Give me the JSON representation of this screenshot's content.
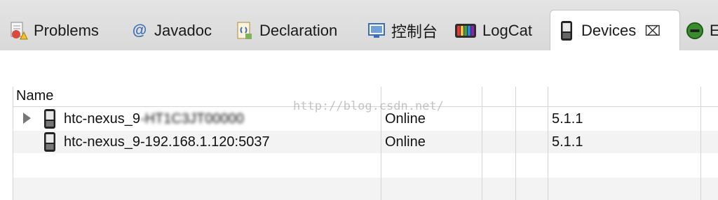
{
  "tabs": [
    {
      "label": "Problems",
      "icon": "problems-icon"
    },
    {
      "label": "Javadoc",
      "icon": "at-icon"
    },
    {
      "label": "Declaration",
      "icon": "declaration-icon"
    },
    {
      "label": "控制台",
      "icon": "console-icon"
    },
    {
      "label": "LogCat",
      "icon": "logcat-icon"
    },
    {
      "label": "Devices",
      "icon": "phone-icon",
      "active": true,
      "close": "⌧"
    },
    {
      "label": "E",
      "icon": "emulator-icon"
    }
  ],
  "table": {
    "header": {
      "name": "Name"
    },
    "rows": [
      {
        "name_visible": "htc-nexus_9",
        "name_obscured": "-HT1C3JT00000",
        "status": "Online",
        "version": "5.1.1",
        "expandable": true
      },
      {
        "name": "htc-nexus_9-192.168.1.120:5037",
        "status": "Online",
        "version": "5.1.1",
        "expandable": false
      }
    ]
  },
  "watermark": "http://blog.csdn.net/",
  "colors": {
    "tabbar_bg": "#dedede",
    "panel_bg": "#ffffff",
    "alt_row_bg": "#f3f3f3",
    "grid_line": "#d4d4d4"
  }
}
